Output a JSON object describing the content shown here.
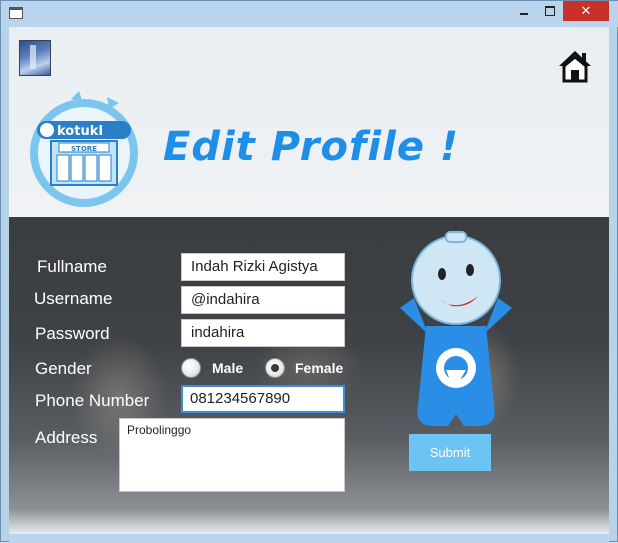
{
  "window": {
    "minimize_glyph": "",
    "close_glyph": "✕"
  },
  "header": {
    "title": "Edit Profile !",
    "logo_text": "kotukI",
    "logo_sign": "STORE"
  },
  "form": {
    "fullname_label": "Fullname",
    "fullname_value": "Indah Rizki Agistya",
    "username_label": "Username",
    "username_value": "@indahira",
    "password_label": "Password",
    "password_value": "indahira",
    "gender_label": "Gender",
    "gender_options": [
      "Male",
      "Female"
    ],
    "gender_selected": "Female",
    "phone_label": "Phone Number",
    "phone_value": "081234567890",
    "address_label": "Address",
    "address_value": "Probolinggo",
    "submit_label": "Submit"
  },
  "colors": {
    "title": "#1e8ee6",
    "submit": "#6cc4f4",
    "close_button": "#c7312a",
    "panel": "#3f4246"
  },
  "icons": {
    "home": "home-icon",
    "thumbnail": "book-thumbnail-icon",
    "mascot": "mascot-icon"
  }
}
